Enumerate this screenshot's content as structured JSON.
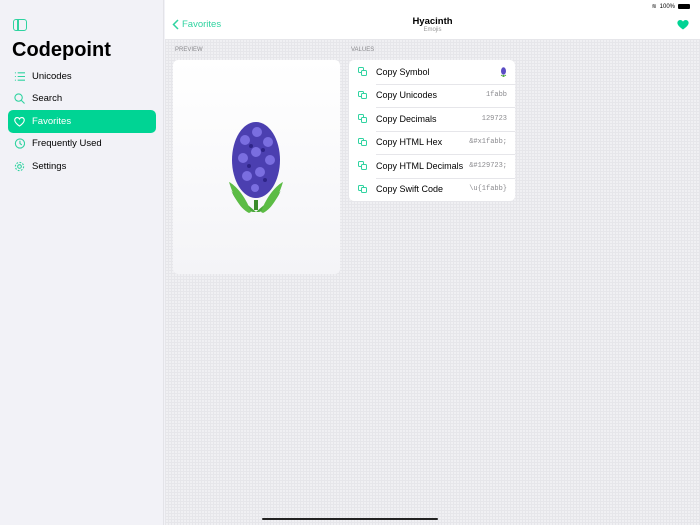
{
  "sidebar": {
    "title": "Codepoint",
    "items": [
      {
        "label": "Unicodes",
        "icon": "list-icon"
      },
      {
        "label": "Search",
        "icon": "search-icon"
      },
      {
        "label": "Favorites",
        "icon": "heart-icon",
        "active": true
      },
      {
        "label": "Frequently Used",
        "icon": "clock-icon"
      },
      {
        "label": "Settings",
        "icon": "gear-icon"
      }
    ]
  },
  "status": {
    "battery": "100%"
  },
  "nav": {
    "back": "Favorites",
    "title": "Hyacinth",
    "subtitle": "Emojis"
  },
  "sections": {
    "preview": "PREVIEW",
    "values": "VALUES"
  },
  "values": [
    {
      "label": "Copy Symbol",
      "value": ""
    },
    {
      "label": "Copy Unicodes",
      "value": "1fabb"
    },
    {
      "label": "Copy Decimals",
      "value": "129723"
    },
    {
      "label": "Copy HTML Hex",
      "value": "&#x1fabb;"
    },
    {
      "label": "Copy HTML Decimals",
      "value": "&#129723;"
    },
    {
      "label": "Copy Swift Code",
      "value": "\\u{1fabb}"
    }
  ],
  "colors": {
    "accent": "#00d494"
  }
}
